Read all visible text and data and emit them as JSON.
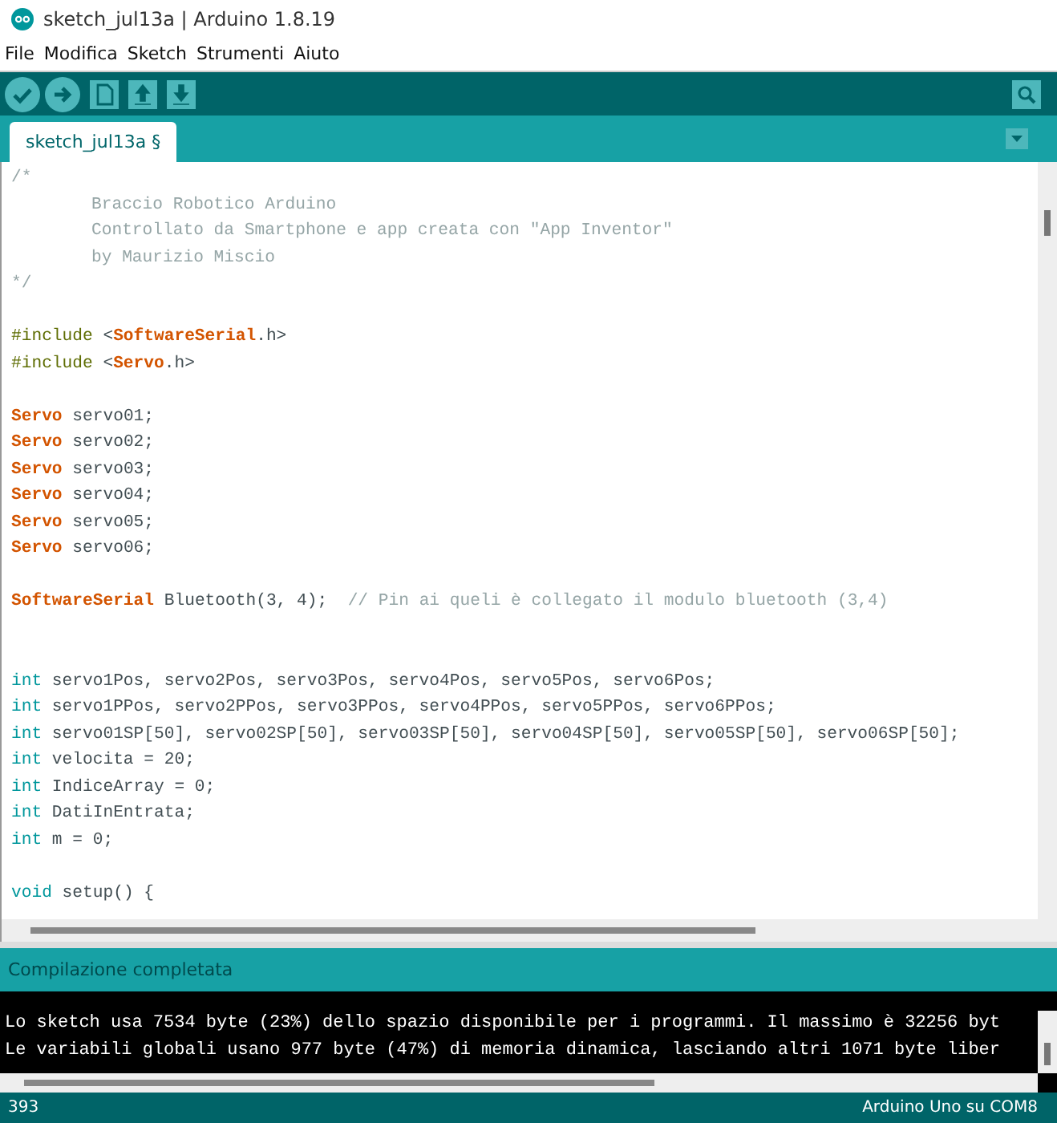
{
  "window": {
    "title": "sketch_jul13a | Arduino 1.8.19"
  },
  "menu": [
    "File",
    "Modifica",
    "Sketch",
    "Strumenti",
    "Aiuto"
  ],
  "tabs": [
    {
      "label": "sketch_jul13a §",
      "selected": true
    }
  ],
  "code": [
    {
      "kind": "code",
      "tokens": [
        {
          "kind": "comment",
          "text": "/*"
        }
      ]
    },
    {
      "kind": "indented",
      "tokens": [
        {
          "kind": "comment",
          "text": "Braccio Robotico Arduino"
        }
      ]
    },
    {
      "kind": "indented",
      "tokens": [
        {
          "kind": "comment",
          "text": "Controllato da Smartphone e app creata con \"App Inventor\""
        }
      ]
    },
    {
      "kind": "indented",
      "tokens": [
        {
          "kind": "comment",
          "text": "by Maurizio Miscio"
        }
      ]
    },
    {
      "kind": "code",
      "tokens": [
        {
          "kind": "comment",
          "text": "*/"
        }
      ]
    },
    {
      "kind": "blank"
    },
    {
      "kind": "code",
      "tokens": [
        {
          "kind": "directive",
          "text": "#include"
        },
        {
          "kind": "plain",
          "text": " <"
        },
        {
          "kind": "keyword",
          "text": "SoftwareSerial"
        },
        {
          "kind": "plain",
          "text": ".h>"
        }
      ]
    },
    {
      "kind": "code",
      "tokens": [
        {
          "kind": "directive",
          "text": "#include"
        },
        {
          "kind": "plain",
          "text": " <"
        },
        {
          "kind": "keyword",
          "text": "Servo"
        },
        {
          "kind": "plain",
          "text": ".h>"
        }
      ]
    },
    {
      "kind": "blank"
    },
    {
      "kind": "code",
      "tokens": [
        {
          "kind": "keyword",
          "text": "Servo"
        },
        {
          "kind": "plain",
          "text": " servo01;"
        }
      ]
    },
    {
      "kind": "code",
      "tokens": [
        {
          "kind": "keyword",
          "text": "Servo"
        },
        {
          "kind": "plain",
          "text": " servo02;"
        }
      ]
    },
    {
      "kind": "code",
      "tokens": [
        {
          "kind": "keyword",
          "text": "Servo"
        },
        {
          "kind": "plain",
          "text": " servo03;"
        }
      ]
    },
    {
      "kind": "code",
      "tokens": [
        {
          "kind": "keyword",
          "text": "Servo"
        },
        {
          "kind": "plain",
          "text": " servo04;"
        }
      ]
    },
    {
      "kind": "code",
      "tokens": [
        {
          "kind": "keyword",
          "text": "Servo"
        },
        {
          "kind": "plain",
          "text": " servo05;"
        }
      ]
    },
    {
      "kind": "code",
      "tokens": [
        {
          "kind": "keyword",
          "text": "Servo"
        },
        {
          "kind": "plain",
          "text": " servo06;"
        }
      ]
    },
    {
      "kind": "blank"
    },
    {
      "kind": "code",
      "tokens": [
        {
          "kind": "keyword",
          "text": "SoftwareSerial"
        },
        {
          "kind": "plain",
          "text": " Bluetooth(3, 4);  "
        },
        {
          "kind": "comment",
          "text": "// Pin ai queli è collegato il modulo bluetooth (3,4)"
        }
      ]
    },
    {
      "kind": "blank"
    },
    {
      "kind": "blank"
    },
    {
      "kind": "code",
      "tokens": [
        {
          "kind": "type",
          "text": "int"
        },
        {
          "kind": "plain",
          "text": " servo1Pos, servo2Pos, servo3Pos, servo4Pos, servo5Pos, servo6Pos;"
        }
      ]
    },
    {
      "kind": "code",
      "tokens": [
        {
          "kind": "type",
          "text": "int"
        },
        {
          "kind": "plain",
          "text": " servo1PPos, servo2PPos, servo3PPos, servo4PPos, servo5PPos, servo6PPos;"
        }
      ]
    },
    {
      "kind": "code",
      "tokens": [
        {
          "kind": "type",
          "text": "int"
        },
        {
          "kind": "plain",
          "text": " servo01SP[50], servo02SP[50], servo03SP[50], servo04SP[50], servo05SP[50], servo06SP[50];"
        }
      ]
    },
    {
      "kind": "code",
      "tokens": [
        {
          "kind": "type",
          "text": "int"
        },
        {
          "kind": "plain",
          "text": " velocita = 20;"
        }
      ]
    },
    {
      "kind": "code",
      "tokens": [
        {
          "kind": "type",
          "text": "int"
        },
        {
          "kind": "plain",
          "text": " IndiceArray = 0;"
        }
      ]
    },
    {
      "kind": "code",
      "tokens": [
        {
          "kind": "type",
          "text": "int"
        },
        {
          "kind": "plain",
          "text": " DatiInEntrata;"
        }
      ]
    },
    {
      "kind": "code",
      "tokens": [
        {
          "kind": "type",
          "text": "int"
        },
        {
          "kind": "plain",
          "text": " m = 0;"
        }
      ]
    },
    {
      "kind": "blank"
    },
    {
      "kind": "code",
      "tokens": [
        {
          "kind": "type",
          "text": "void"
        },
        {
          "kind": "plain",
          "text": " setup() {"
        }
      ]
    }
  ],
  "message": "Compilazione completata",
  "console": [
    "Lo sketch usa 7534 byte (23%) dello spazio disponibile per i programmi. Il massimo è 32256 byt",
    "Le variabili globali usano 977 byte (47%) di memoria dinamica, lasciando altri 1071 byte liber"
  ],
  "status_bar": {
    "line": "393",
    "board": "Arduino Uno su COM8"
  }
}
